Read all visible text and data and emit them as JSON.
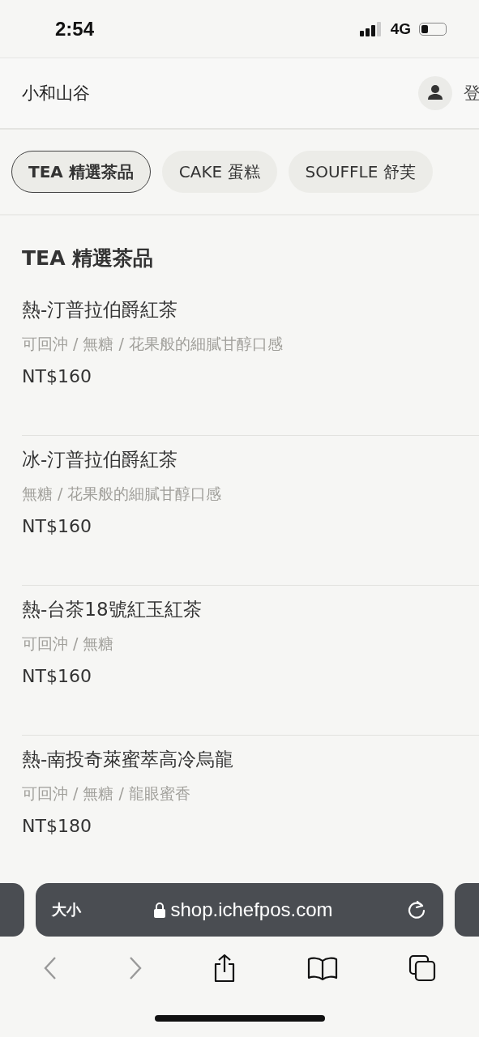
{
  "status_bar": {
    "time": "2:54",
    "network": "4G"
  },
  "header": {
    "shop_name": "小和山谷",
    "login": "登"
  },
  "categories": [
    {
      "label": "TEA 精選茶品",
      "selected": true
    },
    {
      "label": "CAKE 蛋糕",
      "selected": false
    },
    {
      "label": "SOUFFLE 舒芙",
      "selected": false
    }
  ],
  "section": {
    "title": "TEA 精選茶品",
    "items": [
      {
        "name": "熱-汀普拉伯爵紅茶",
        "description": "可回沖 / 無糖 / 花果般的細膩甘醇口感",
        "price": "NT$160"
      },
      {
        "name": "冰-汀普拉伯爵紅茶",
        "description": "無糖 / 花果般的細膩甘醇口感",
        "price": "NT$160"
      },
      {
        "name": "熱-台茶18號紅玉紅茶",
        "description": "可回沖 / 無糖",
        "price": "NT$160"
      },
      {
        "name": "熱-南投奇萊蜜萃高冷烏龍",
        "description": "可回沖 / 無糖 / 龍眼蜜香",
        "price": "NT$180"
      }
    ]
  },
  "browser": {
    "text_size": "大小",
    "url": "shop.ichefpos.com",
    "back_disabled": true,
    "forward_disabled": true
  }
}
